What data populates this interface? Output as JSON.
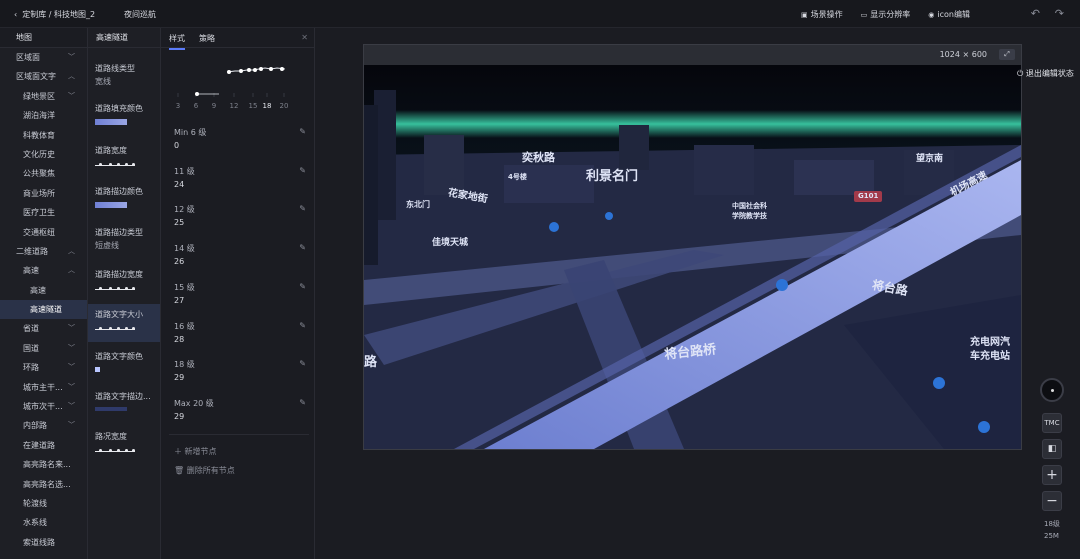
{
  "topbar": {
    "back_label": "定制库 / 科技地图_2",
    "mode_label": "夜间巡航",
    "actions": [
      {
        "icon": "camera-icon",
        "label": "场景操作"
      },
      {
        "icon": "monitor-icon",
        "label": "显示分辨率"
      },
      {
        "icon": "pin-icon",
        "label": "icon编辑"
      }
    ]
  },
  "col1": {
    "header": "地图",
    "items": [
      {
        "label": "区域面",
        "level": 1,
        "chevron": "down"
      },
      {
        "label": "区域面文字",
        "level": 1,
        "chevron": "up"
      },
      {
        "label": "绿地景区",
        "level": 2,
        "chevron": "down"
      },
      {
        "label": "湖泊海洋",
        "level": 2,
        "chevron": ""
      },
      {
        "label": "科教体育",
        "level": 2,
        "chevron": ""
      },
      {
        "label": "文化历史",
        "level": 2,
        "chevron": ""
      },
      {
        "label": "公共聚焦",
        "level": 2,
        "chevron": ""
      },
      {
        "label": "商业场所",
        "level": 2,
        "chevron": ""
      },
      {
        "label": "医疗卫生",
        "level": 2,
        "chevron": ""
      },
      {
        "label": "交通枢纽",
        "level": 2,
        "chevron": ""
      },
      {
        "label": "二维道路",
        "level": 1,
        "chevron": "up"
      },
      {
        "label": "高速",
        "level": 2,
        "chevron": "up"
      },
      {
        "label": "高速",
        "level": 3,
        "chevron": ""
      },
      {
        "label": "高速隧道",
        "level": 3,
        "chevron": "",
        "active": true
      },
      {
        "label": "省道",
        "level": 2,
        "chevron": "down"
      },
      {
        "label": "国道",
        "level": 2,
        "chevron": "down"
      },
      {
        "label": "环路",
        "level": 2,
        "chevron": "down"
      },
      {
        "label": "城市主干...",
        "level": 2,
        "chevron": "down"
      },
      {
        "label": "城市次干...",
        "level": 2,
        "chevron": "down"
      },
      {
        "label": "内部路",
        "level": 2,
        "chevron": "down"
      },
      {
        "label": "在建道路",
        "level": 2,
        "chevron": ""
      },
      {
        "label": "高亮路名来...",
        "level": 2,
        "chevron": ""
      },
      {
        "label": "高亮路名选...",
        "level": 2,
        "chevron": ""
      },
      {
        "label": "轮渡线",
        "level": 2,
        "chevron": ""
      },
      {
        "label": "水系线",
        "level": 2,
        "chevron": ""
      },
      {
        "label": "索道线路",
        "level": 2,
        "chevron": ""
      }
    ]
  },
  "col2": {
    "header": "高速隧道",
    "items": [
      {
        "label": "道路线类型",
        "sub": "宽线",
        "kind": "text",
        "active": false
      },
      {
        "label": "道路填充颜色",
        "sub": "",
        "kind": "swatch",
        "active": false
      },
      {
        "label": "道路宽度",
        "sub": "",
        "kind": "mini",
        "active": false
      },
      {
        "label": "道路描边颜色",
        "sub": "",
        "kind": "swatch",
        "active": false
      },
      {
        "label": "道路描边类型",
        "sub": "短虚线",
        "kind": "text",
        "active": false
      },
      {
        "label": "道路描边宽度",
        "sub": "",
        "kind": "mini",
        "active": false
      },
      {
        "label": "道路文字大小",
        "sub": "",
        "kind": "mini",
        "active": true
      },
      {
        "label": "道路文字颜色",
        "sub": "",
        "kind": "small",
        "active": false
      },
      {
        "label": "道路文字描边...",
        "sub": "",
        "kind": "dark",
        "active": false
      },
      {
        "label": "路况宽度",
        "sub": "",
        "kind": "mini",
        "active": false
      }
    ]
  },
  "col3": {
    "tabs": [
      "样式",
      "策略"
    ],
    "active_tab": 0,
    "axis_ticks": [
      "3",
      "6",
      "9",
      "12",
      "15",
      "18",
      "20"
    ],
    "highlight_tick": "18",
    "levels": [
      {
        "name": "Min 6 级",
        "value": "0"
      },
      {
        "name": "11 级",
        "value": "24"
      },
      {
        "name": "12 级",
        "value": "25"
      },
      {
        "name": "14 级",
        "value": "26"
      },
      {
        "name": "15 级",
        "value": "27"
      },
      {
        "name": "16 级",
        "value": "28"
      },
      {
        "name": "18 级",
        "value": "29"
      },
      {
        "name": "Max 20 级",
        "value": "29"
      }
    ],
    "add_node": "新增节点",
    "delete_nodes": "删除所有节点"
  },
  "map": {
    "size_label": "1024 × 600",
    "exit_edit": "退出编辑状态",
    "labels": [
      {
        "text": "奕秋路"
      },
      {
        "text": "利景名门"
      },
      {
        "text": "4号楼"
      },
      {
        "text": "望京南"
      },
      {
        "text": "花家地街"
      },
      {
        "text": "东北门"
      },
      {
        "text": "中国社会科"
      },
      {
        "text": "学院教学技"
      },
      {
        "text": "G101"
      },
      {
        "text": "机场高速"
      },
      {
        "text": "佳境天城"
      },
      {
        "text": "将台路"
      },
      {
        "text": "将台路桥"
      },
      {
        "text": "充电网汽"
      },
      {
        "text": "车充电站"
      },
      {
        "text": "路"
      }
    ]
  },
  "rtools": {
    "tmc": "TMC",
    "zoom_level": "18级",
    "scale": "25M"
  },
  "colors": {
    "accent": "#5c7cfa",
    "active_row": "#2a3248",
    "aurora": "#3fe0b4",
    "road": "#8ea0e6"
  }
}
